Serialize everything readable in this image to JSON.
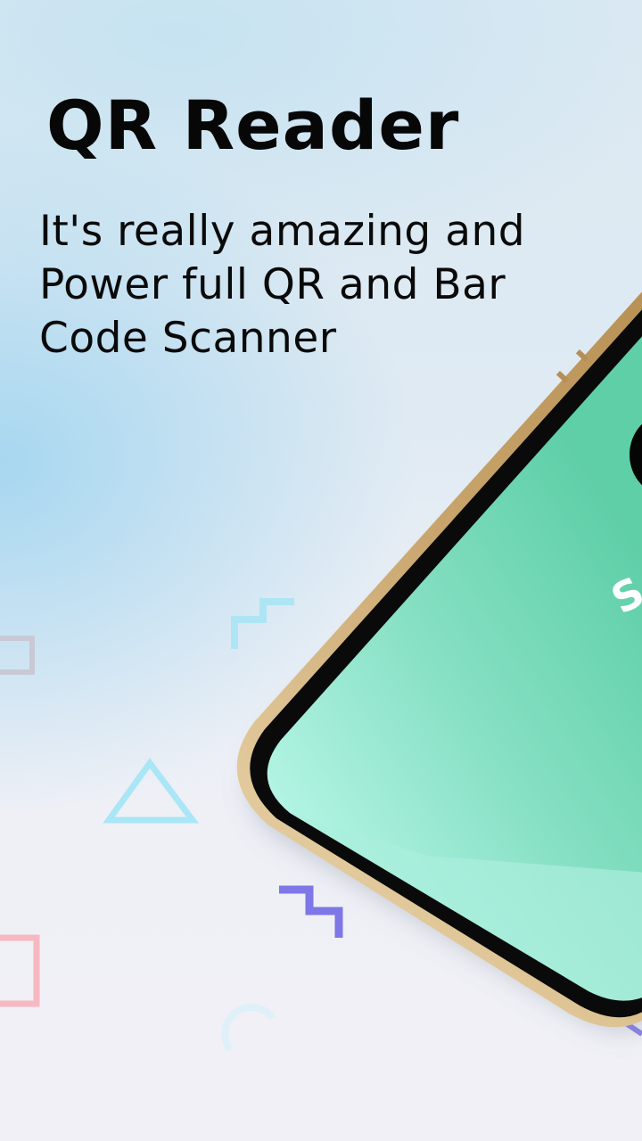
{
  "title": "QR Reader",
  "subtitle_lines": [
    "It's really amazing and",
    "Power full QR and Bar",
    "Code Scanner"
  ],
  "screen_partial_text": "S",
  "colors": {
    "title": "#070707",
    "screen_light": "#b6f5e6",
    "screen_dark": "#5fcfa8",
    "phone_frame": "#c8a97a",
    "deco_cyan": "#a8e6f5",
    "deco_purple": "#7b72e6",
    "deco_pink": "#f6b6bf"
  },
  "icons": [
    "stair-step-shape-icon",
    "triangle-outline-icon",
    "square-outline-icon",
    "arc-outline-icon",
    "stair-step-purple-icon"
  ]
}
